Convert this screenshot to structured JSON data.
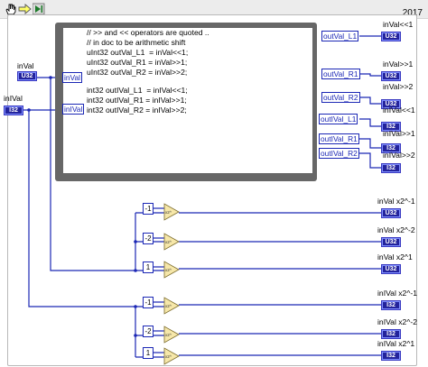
{
  "toolbar": {
    "icons": [
      "hand-cursor-icon",
      "highlight-arrow-icon",
      "step-icon"
    ],
    "version_label": "2017"
  },
  "inputs": {
    "inval_label": "inVal",
    "inval_type": "U32",
    "inival_label": "inIVal",
    "inival_type": "I32"
  },
  "formula_node": {
    "code_lines": [
      "// >> and << operators are quoted ..",
      "// in doc to be arithmetic shift",
      "uInt32 outVal_L1  = inVal<<1;",
      "uInt32 outVal_R1 = inVal>>1;",
      "uInt32 outVal_R2 = inVal>>2;",
      "",
      "int32 outIVal_L1  = inIVal<<1;",
      "int32 outIVal_R1 = inIVal>>1;",
      "int32 outIVal_R2 = inIVal>>2;"
    ],
    "input_terminals": [
      "inVal",
      "inIVal"
    ],
    "output_terminals": [
      "outVal_L1",
      "outVal_R1",
      "outVal_R2",
      "outIVal_L1",
      "outIVal_R1",
      "outIVal_R2"
    ]
  },
  "outputs": [
    {
      "label": "inVal<<1",
      "type": "U32"
    },
    {
      "label": "inVal>>1",
      "type": "U32"
    },
    {
      "label": "inVal>>2",
      "type": "U32"
    },
    {
      "label": "inIVal<<1",
      "type": "I32"
    },
    {
      "label": "inIVal>>1",
      "type": "I32"
    },
    {
      "label": "inIVal>>2",
      "type": "I32"
    }
  ],
  "scale_ops": [
    {
      "constant": "-1",
      "node_label": "x2^",
      "label": "inVal x2^-1",
      "type": "U32"
    },
    {
      "constant": "-2",
      "node_label": "x2^",
      "label": "inVal x2^-2",
      "type": "U32"
    },
    {
      "constant": "1",
      "node_label": "x2^",
      "label": "inVal  x2^1",
      "type": "U32"
    },
    {
      "constant": "-1",
      "node_label": "x2^",
      "label": "inIVal x2^-1",
      "type": "I32"
    },
    {
      "constant": "-2",
      "node_label": "x2^",
      "label": "inIVal  x2^-2",
      "type": "I32"
    },
    {
      "constant": "1",
      "node_label": "x2^",
      "label": "inIVal  x2^1",
      "type": "I32"
    }
  ],
  "colors": {
    "wire": "#1b27b5",
    "indicator": "#23239c",
    "frame": "#676767",
    "scale_node": "#f6e7a9"
  }
}
